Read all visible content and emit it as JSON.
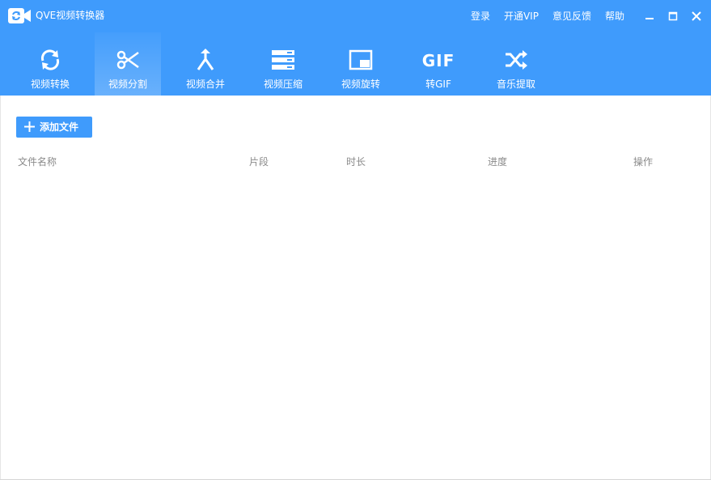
{
  "app": {
    "title": "QVE视频转换器"
  },
  "top_links": {
    "login": "登录",
    "vip": "开通VIP",
    "feedback": "意见反馈",
    "help": "帮助"
  },
  "toolbar": {
    "items": [
      {
        "label": "视频转换",
        "icon": "refresh-icon"
      },
      {
        "label": "视频分割",
        "icon": "scissors-icon",
        "active": true
      },
      {
        "label": "视频合并",
        "icon": "merge-icon"
      },
      {
        "label": "视频压缩",
        "icon": "compress-icon"
      },
      {
        "label": "视频旋转",
        "icon": "rotate-icon"
      },
      {
        "label": "转GIF",
        "icon": "gif-icon",
        "icon_text": "GIF"
      },
      {
        "label": "音乐提取",
        "icon": "shuffle-icon"
      }
    ]
  },
  "main": {
    "add_file_label": "添加文件",
    "columns": [
      "文件名称",
      "片段",
      "时长",
      "进度",
      "操作"
    ]
  },
  "colors": {
    "accent": "#3f9bfc",
    "header_text": "#ffffff",
    "column_text": "#8a8a8a"
  }
}
